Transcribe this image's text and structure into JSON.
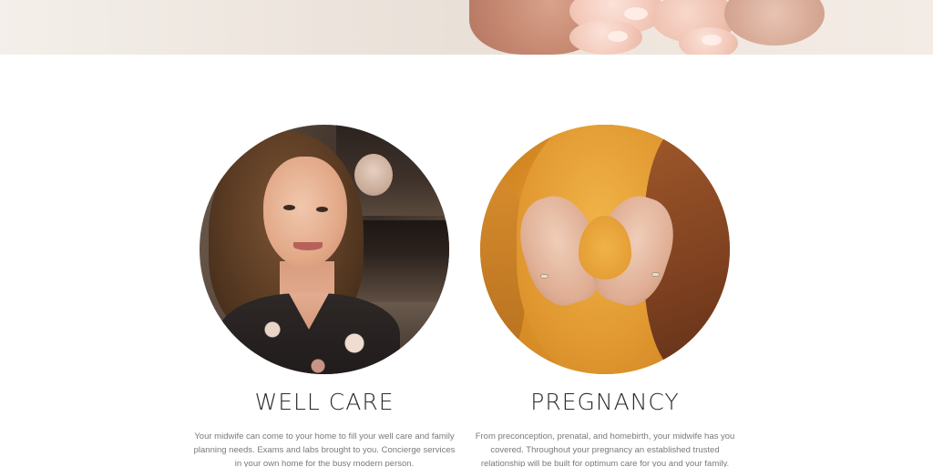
{
  "services": [
    {
      "title": "WELL CARE",
      "description": "Your midwife can come to your home to fill your well care and family planning needs. Exams and labs brought to you. Concierge services in your own home for the busy modern person."
    },
    {
      "title": "PREGNANCY",
      "description": "From preconception, prenatal, and homebirth, your midwife has you covered. Throughout your pregnancy an established trusted relationship will be built for optimum care for you and your family."
    }
  ]
}
